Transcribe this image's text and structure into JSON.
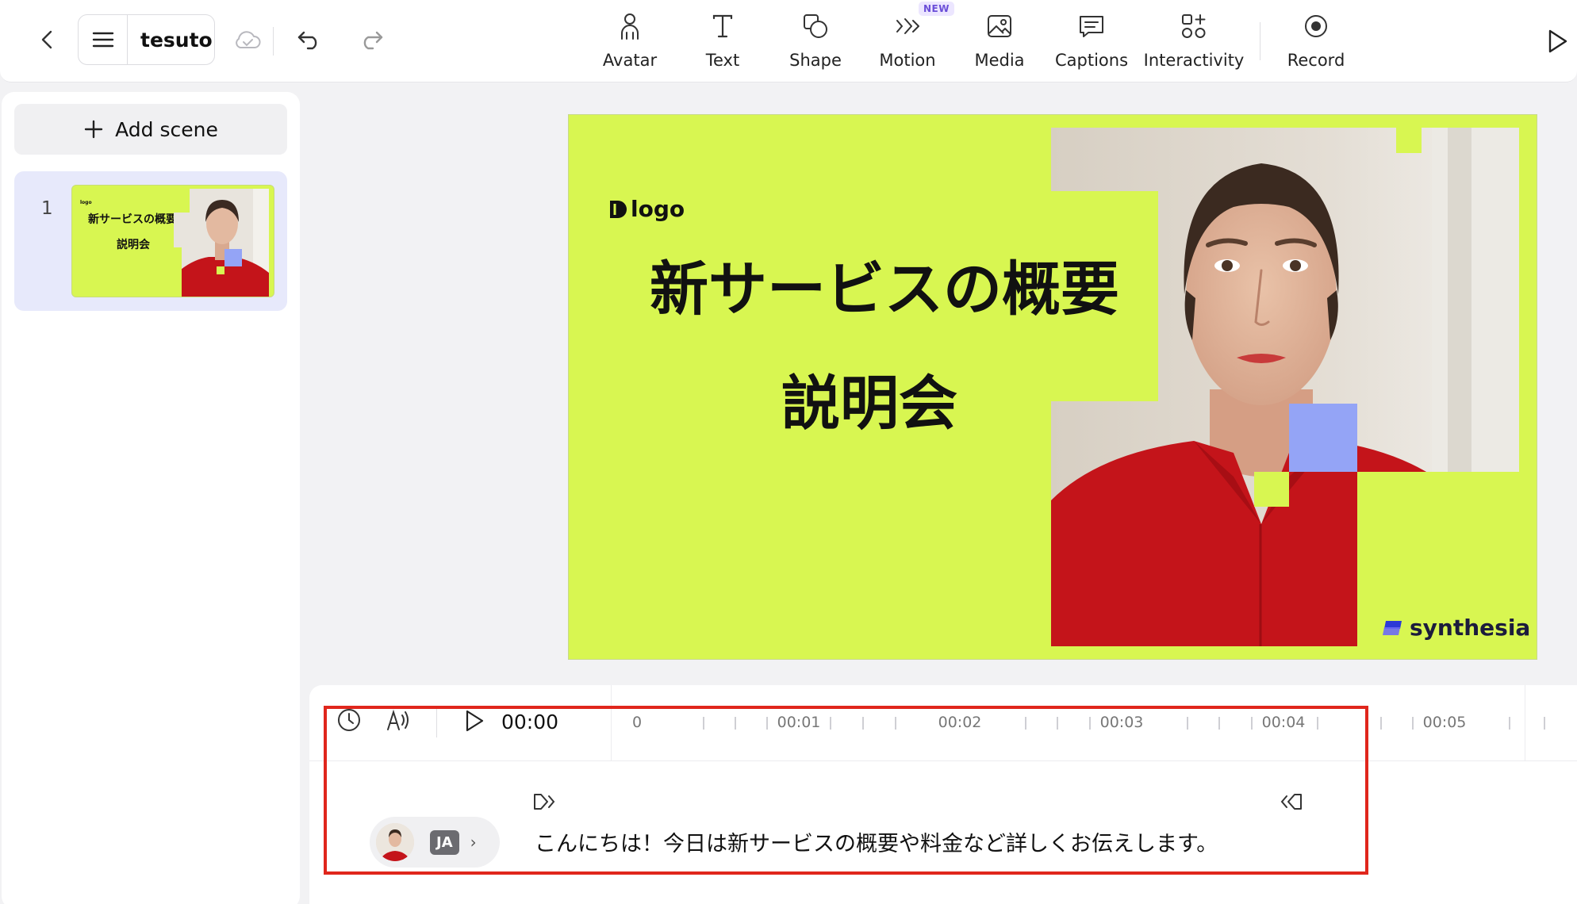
{
  "header": {
    "project_title": "tesuto",
    "tools": [
      {
        "label": "Avatar",
        "icon": "avatar-icon"
      },
      {
        "label": "Text",
        "icon": "text-icon"
      },
      {
        "label": "Shape",
        "icon": "shape-icon"
      },
      {
        "label": "Motion",
        "icon": "motion-icon",
        "badge": "NEW"
      },
      {
        "label": "Media",
        "icon": "media-icon"
      },
      {
        "label": "Captions",
        "icon": "captions-icon"
      },
      {
        "label": "Interactivity",
        "icon": "interactivity-icon"
      },
      {
        "label": "Record",
        "icon": "record-icon"
      }
    ]
  },
  "sidebar": {
    "add_scene_label": "Add scene",
    "scenes": [
      {
        "number": "1",
        "thumb_logo": "logo",
        "thumb_title_1": "新サービスの概要",
        "thumb_title_2": "説明会"
      }
    ]
  },
  "slide": {
    "logo_text": "logo",
    "title_line_1": "新サービスの概要",
    "title_line_2": "説明会",
    "brand": "synthesia",
    "colors": {
      "background": "#d8f651",
      "accent_square": "#94a4f6",
      "shirt": "#c4141a"
    }
  },
  "timeline": {
    "current_time": "00:00",
    "ticks": [
      "0",
      "00:01",
      "00:02",
      "00:03",
      "00:04",
      "00:05"
    ],
    "language_badge": "JA",
    "script": "こんにちは！今日は新サービスの概要や料金など詳しくお伝えします。"
  }
}
